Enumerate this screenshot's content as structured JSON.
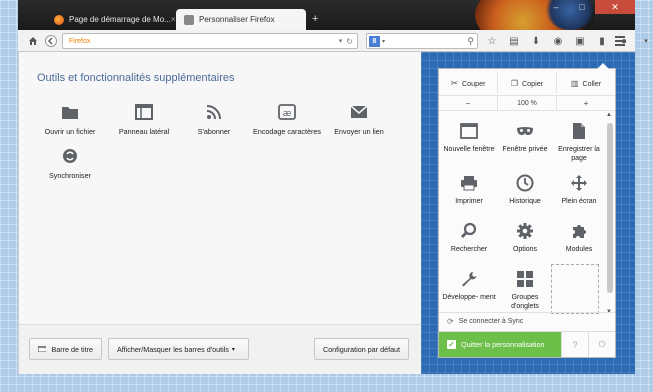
{
  "tabs": [
    {
      "label": "Page de démarrage de Mo..."
    },
    {
      "label": "Personnaliser Firefox"
    }
  ],
  "url": {
    "text": "Firefox"
  },
  "search": {
    "engine": "8"
  },
  "customize": {
    "title": "Outils et fonctionnalités supplémentaires",
    "tools": [
      {
        "label": "Ouvrir un fichier",
        "icon": "folder-icon"
      },
      {
        "label": "Panneau latéral",
        "icon": "sidebar-icon"
      },
      {
        "label": "S'abonner",
        "icon": "rss-icon"
      },
      {
        "label": "Encodage caractères",
        "icon": "encoding-icon"
      },
      {
        "label": "Envoyer un lien",
        "icon": "envelope-icon"
      },
      {
        "label": "Synchroniser",
        "icon": "sync-icon"
      }
    ],
    "footer": {
      "titlebar": "Barre de titre",
      "toolbars": "Afficher/Masquer les barres d'outils",
      "restore": "Configuration par défaut"
    }
  },
  "panel": {
    "cut": "Couper",
    "copy": "Copier",
    "paste": "Coller",
    "zoom_minus": "−",
    "zoom_level": "100 %",
    "zoom_plus": "+",
    "items": [
      {
        "label": "Nouvelle fenêtre",
        "icon": "window-icon"
      },
      {
        "label": "Fenêtre privée",
        "icon": "mask-icon"
      },
      {
        "label": "Enregistrer la page",
        "icon": "page-icon"
      },
      {
        "label": "Imprimer",
        "icon": "printer-icon"
      },
      {
        "label": "Historique",
        "icon": "clock-icon"
      },
      {
        "label": "Plein écran",
        "icon": "fullscreen-icon"
      },
      {
        "label": "Rechercher",
        "icon": "magnifier-icon"
      },
      {
        "label": "Options",
        "icon": "gear-icon"
      },
      {
        "label": "Modules",
        "icon": "puzzle-icon"
      },
      {
        "label": "Développe- ment",
        "icon": "wrench-icon"
      },
      {
        "label": "Groupes d'onglets",
        "icon": "grid-icon"
      }
    ],
    "sync": "Se connecter à Sync",
    "quit": "Quitter la personnalisation"
  },
  "colors": {
    "accent": "#6cc04a",
    "panel_bg": "#2c6bb4",
    "title": "#4a6a9a"
  }
}
